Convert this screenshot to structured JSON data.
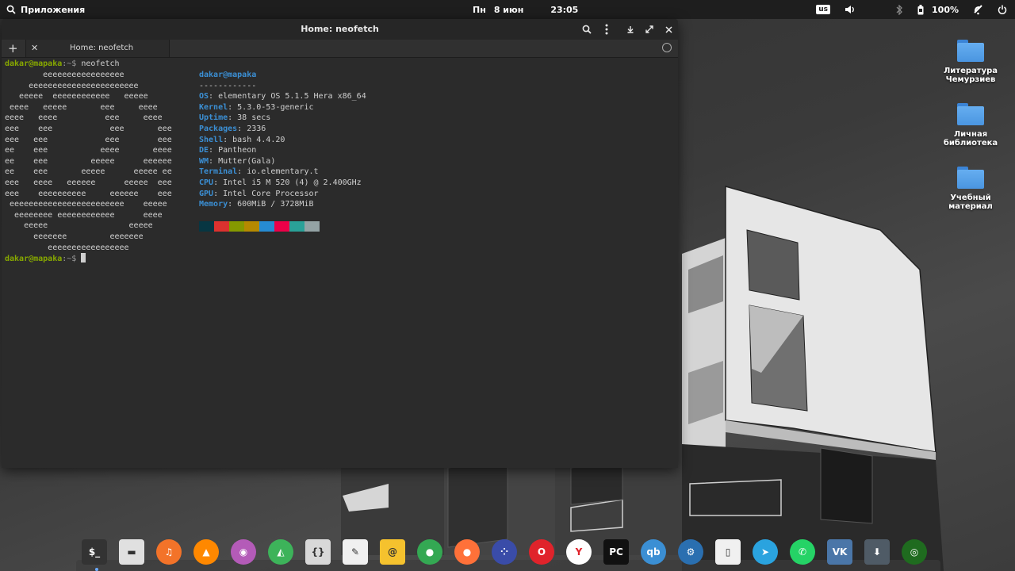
{
  "panel": {
    "apps_label": "Приложения",
    "day": "Пн",
    "date": "8 июн",
    "time": "23:05",
    "keyboard_layout": "us",
    "battery_percent": "100%"
  },
  "window": {
    "title": "Home: neofetch",
    "tab_label": "Home: neofetch"
  },
  "terminal": {
    "prompt_user": "dakar@mapaka",
    "prompt_path": ":~$ ",
    "command": "neofetch",
    "art": [
      "        eeeeeeeeeeeeeeeee",
      "     eeeeeeeeeeeeeeeeeeeeeee",
      "   eeeee  eeeeeeeeeeee   eeeee",
      " eeee   eeeee       eee     eeee",
      "eeee   eeee          eee     eeee",
      "eee    eee            eee       eee",
      "eee   eee            eee        eee",
      "ee    eee           eeee       eeee",
      "ee    eee         eeeee      eeeeee",
      "ee    eee       eeeee      eeeee ee",
      "eee   eeee   eeeeee      eeeee  eee",
      "eee    eeeeeeeeee     eeeeee    eee",
      " eeeeeeeeeeeeeeeeeeeeeeee    eeeee",
      "  eeeeeeee eeeeeeeeeeee      eeee",
      "    eeeee                 eeeee",
      "      eeeeeee         eeeeeee",
      "         eeeeeeeeeeeeeeeee"
    ],
    "user_host": "dakar@mapaka",
    "separator": "------------",
    "info": [
      {
        "key": "OS",
        "value": ": elementary OS 5.1.5 Hera x86_64"
      },
      {
        "key": "Kernel",
        "value": ": 5.3.0-53-generic"
      },
      {
        "key": "Uptime",
        "value": ": 38 secs"
      },
      {
        "key": "Packages",
        "value": ": 2336"
      },
      {
        "key": "Shell",
        "value": ": bash 4.4.20"
      },
      {
        "key": "DE",
        "value": ": Pantheon"
      },
      {
        "key": "WM",
        "value": ": Mutter(Gala)"
      },
      {
        "key": "Terminal",
        "value": ": io.elementary.t"
      },
      {
        "key": "CPU",
        "value": ": Intel i5 M 520 (4) @ 2.400GHz"
      },
      {
        "key": "GPU",
        "value": ": Intel Core Processor"
      },
      {
        "key": "Memory",
        "value": ": 600MiB / 3728MiB"
      }
    ],
    "palette": [
      "#073642",
      "#dc322f",
      "#859900",
      "#b58900",
      "#268bd2",
      "#ec0048",
      "#2aa198",
      "#94a3a5"
    ]
  },
  "desktop": {
    "icons": [
      {
        "label": "Литература\nЧемурзиев"
      },
      {
        "label": "Личная\nбиблиотека"
      },
      {
        "label": "Учебный\nматериал"
      }
    ]
  },
  "dock": {
    "apps": [
      {
        "icon": "terminal-icon",
        "glyph": "$_",
        "color": "#333333"
      },
      {
        "icon": "files-icon",
        "glyph": "▬",
        "color": "#e0e0e0"
      },
      {
        "icon": "music-icon",
        "glyph": "♫",
        "color": "#f37329"
      },
      {
        "icon": "vlc-icon",
        "glyph": "▲",
        "color": "#ff8800"
      },
      {
        "icon": "eye-of-gnome-icon",
        "glyph": "◉",
        "color": "#b45bb8"
      },
      {
        "icon": "photos-icon",
        "glyph": "◭",
        "color": "#3db35a"
      },
      {
        "icon": "code-icon",
        "glyph": "{}",
        "color": "#d8d8d8"
      },
      {
        "icon": "text-editor-icon",
        "glyph": "✎",
        "color": "#f0f0f0"
      },
      {
        "icon": "mail-icon",
        "glyph": "@",
        "color": "#f5c22e"
      },
      {
        "icon": "chrome-icon",
        "glyph": "●",
        "color": "#34a853"
      },
      {
        "icon": "firefox-icon",
        "glyph": "●",
        "color": "#ff7139"
      },
      {
        "icon": "kodi-icon",
        "glyph": "⁘",
        "color": "#3a4ca8"
      },
      {
        "icon": "opera-icon",
        "glyph": "O",
        "color": "#e0232b"
      },
      {
        "icon": "yandex-browser-icon",
        "glyph": "Y",
        "color": "#ffffff"
      },
      {
        "icon": "pycharm-icon",
        "glyph": "PC",
        "color": "#111111"
      },
      {
        "icon": "qbittorrent-icon",
        "glyph": "qb",
        "color": "#3b8fd4"
      },
      {
        "icon": "steam-icon",
        "glyph": "⚙",
        "color": "#2a6fb0"
      },
      {
        "icon": "document-icon",
        "glyph": "▯",
        "color": "#f0f0f0"
      },
      {
        "icon": "telegram-icon",
        "glyph": "➤",
        "color": "#2aa3df"
      },
      {
        "icon": "whatsapp-icon",
        "glyph": "✆",
        "color": "#25d366"
      },
      {
        "icon": "vk-icon",
        "glyph": "VK",
        "color": "#4a76a8"
      },
      {
        "icon": "downloads-icon",
        "glyph": "⬇",
        "color": "#4f5b66"
      },
      {
        "icon": "radar-icon",
        "glyph": "◎",
        "color": "#1f6b1f"
      }
    ]
  }
}
